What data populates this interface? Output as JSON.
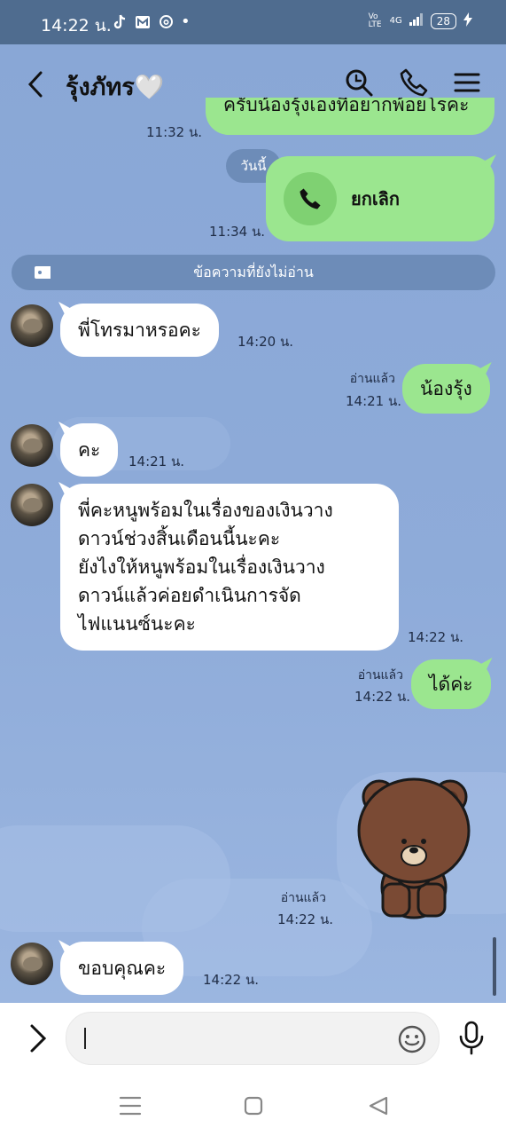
{
  "status_bar": {
    "time": "14:22 น.",
    "dot": "•",
    "network": "4G",
    "volte": "Vo LTE",
    "battery": "28",
    "icons": [
      "tiktok-icon",
      "gmail-icon",
      "threads-icon",
      "signal-icon",
      "battery-icon",
      "charging-icon"
    ]
  },
  "header": {
    "title": "รุ้งภัทร🤍",
    "icons": [
      "back-chevron-icon",
      "search-icon",
      "phone-icon",
      "menu-icon"
    ]
  },
  "messages": {
    "partial_top": {
      "text": "ครับน้องรุ้งเองที่อยากพ้อยโรคะ",
      "time": "11:32 น."
    },
    "today_label": "วันนี้",
    "call": {
      "label": "ยกเลิก",
      "time": "11:34 น."
    },
    "unread_label": "ข้อความที่ยังไม่อ่าน",
    "m1": {
      "text": "พี่โทรมาหรอคะ",
      "time": "14:20 น."
    },
    "m2": {
      "text": "น้องรุ้ง",
      "read": "อ่านแล้ว",
      "time": "14:21 น."
    },
    "m3": {
      "text": "คะ",
      "time": "14:21 น."
    },
    "m4": {
      "lines": [
        "พี่คะหนูพร้อมในเรื่องของเงินวาง",
        "ดาวน์ช่วงสิ้นเดือนนี้นะคะ",
        "ยังไงให้หนูพร้อมในเรื่องเงินวาง",
        "ดาวน์แล้วค่อยดำเนินการจัด",
        "ไฟแนนซ์นะคะ"
      ],
      "time": "14:22 น."
    },
    "m5": {
      "text": "ได้ค่ะ",
      "read": "อ่านแล้ว",
      "time": "14:22 น."
    },
    "sticker": {
      "name": "brown-bear-sticker",
      "read": "อ่านแล้ว",
      "time": "14:22 น."
    },
    "m6": {
      "text": "ขอบคุณคะ",
      "time": "14:22 น."
    }
  },
  "input": {
    "value": "",
    "placeholder": ""
  },
  "colors": {
    "header_bg": "#4f6c8f",
    "chat_bg": "#8aa9d6",
    "sent_bubble": "#9be68f",
    "received_bubble": "#ffffff",
    "pill": "#6d8cb8"
  }
}
